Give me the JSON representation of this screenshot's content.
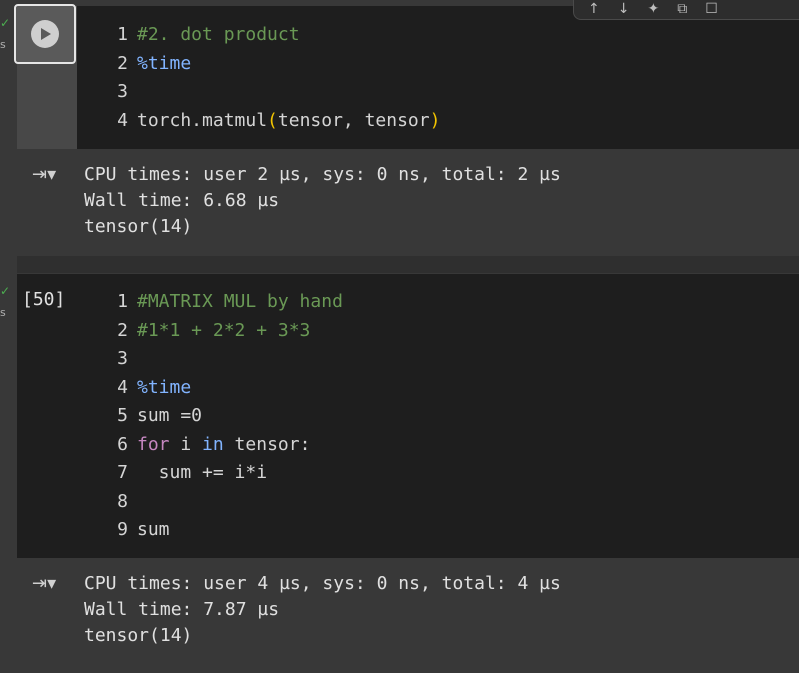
{
  "status": {
    "check_glyph": "✓",
    "suffix": "s"
  },
  "toolbar": {
    "icons": [
      "move-up-icon",
      "move-down-icon",
      "sparkle-icon",
      "link-icon",
      "comment-icon"
    ],
    "glyphs": [
      "↑",
      "↓",
      "✦",
      "⧉",
      "☐"
    ]
  },
  "cell1": {
    "lines": [
      {
        "num": "1",
        "text": "#2. dot product"
      },
      {
        "num": "2",
        "text": "%time"
      },
      {
        "num": "3",
        "text": ""
      },
      {
        "num": "4",
        "pre": "torch.matmul",
        "open": "(",
        "mid": "tensor, tensor",
        "close": ")"
      }
    ],
    "output": [
      "CPU times: user 2 µs, sys: 0 ns, total: 2 µs",
      "Wall time: 6.68 µs",
      "tensor(14)"
    ]
  },
  "cell2": {
    "exec_count": "[50]",
    "lines": [
      {
        "num": "1",
        "text": "#MATRIX MUL by hand"
      },
      {
        "num": "2",
        "text": "#1*1 + 2*2 + 3*3"
      },
      {
        "num": "3",
        "text": ""
      },
      {
        "num": "4",
        "text": "%time"
      },
      {
        "num": "5",
        "text": "sum =0"
      },
      {
        "num": "6",
        "kw1": "for",
        "a": " i ",
        "kw2": "in",
        "b": " tensor:"
      },
      {
        "num": "7",
        "text": "  sum += i*i"
      },
      {
        "num": "8",
        "text": ""
      },
      {
        "num": "9",
        "text": "sum"
      }
    ],
    "output": [
      "CPU times: user 4 µs, sys: 0 ns, total: 4 µs",
      "Wall time: 7.87 µs",
      "tensor(14)"
    ]
  },
  "output_icon_glyph": "⇥▾"
}
